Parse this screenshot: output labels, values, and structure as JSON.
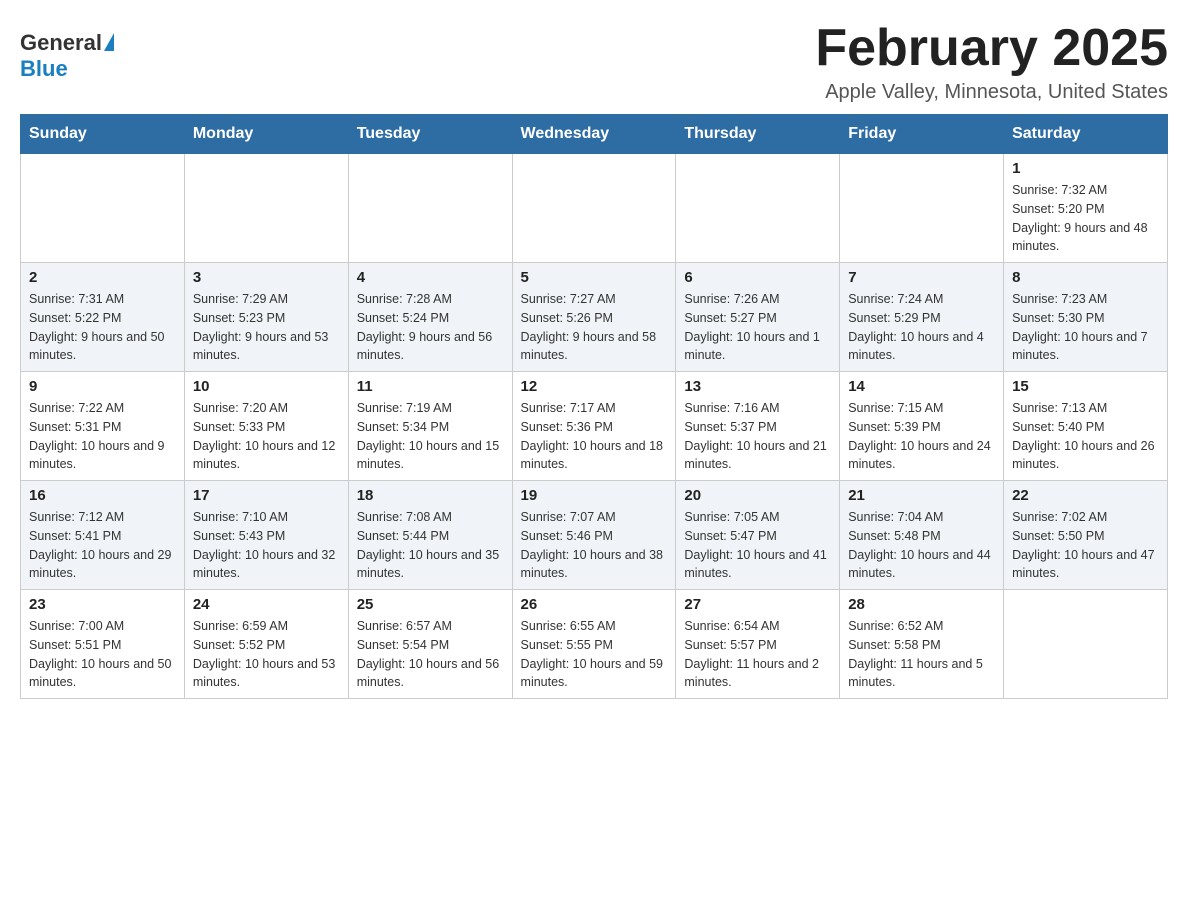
{
  "header": {
    "logo_general": "General",
    "logo_blue": "Blue",
    "month_title": "February 2025",
    "location": "Apple Valley, Minnesota, United States"
  },
  "days_of_week": [
    "Sunday",
    "Monday",
    "Tuesday",
    "Wednesday",
    "Thursday",
    "Friday",
    "Saturday"
  ],
  "weeks": [
    {
      "days": [
        {
          "date": "",
          "info": ""
        },
        {
          "date": "",
          "info": ""
        },
        {
          "date": "",
          "info": ""
        },
        {
          "date": "",
          "info": ""
        },
        {
          "date": "",
          "info": ""
        },
        {
          "date": "",
          "info": ""
        },
        {
          "date": "1",
          "info": "Sunrise: 7:32 AM\nSunset: 5:20 PM\nDaylight: 9 hours and 48 minutes."
        }
      ]
    },
    {
      "days": [
        {
          "date": "2",
          "info": "Sunrise: 7:31 AM\nSunset: 5:22 PM\nDaylight: 9 hours and 50 minutes."
        },
        {
          "date": "3",
          "info": "Sunrise: 7:29 AM\nSunset: 5:23 PM\nDaylight: 9 hours and 53 minutes."
        },
        {
          "date": "4",
          "info": "Sunrise: 7:28 AM\nSunset: 5:24 PM\nDaylight: 9 hours and 56 minutes."
        },
        {
          "date": "5",
          "info": "Sunrise: 7:27 AM\nSunset: 5:26 PM\nDaylight: 9 hours and 58 minutes."
        },
        {
          "date": "6",
          "info": "Sunrise: 7:26 AM\nSunset: 5:27 PM\nDaylight: 10 hours and 1 minute."
        },
        {
          "date": "7",
          "info": "Sunrise: 7:24 AM\nSunset: 5:29 PM\nDaylight: 10 hours and 4 minutes."
        },
        {
          "date": "8",
          "info": "Sunrise: 7:23 AM\nSunset: 5:30 PM\nDaylight: 10 hours and 7 minutes."
        }
      ]
    },
    {
      "days": [
        {
          "date": "9",
          "info": "Sunrise: 7:22 AM\nSunset: 5:31 PM\nDaylight: 10 hours and 9 minutes."
        },
        {
          "date": "10",
          "info": "Sunrise: 7:20 AM\nSunset: 5:33 PM\nDaylight: 10 hours and 12 minutes."
        },
        {
          "date": "11",
          "info": "Sunrise: 7:19 AM\nSunset: 5:34 PM\nDaylight: 10 hours and 15 minutes."
        },
        {
          "date": "12",
          "info": "Sunrise: 7:17 AM\nSunset: 5:36 PM\nDaylight: 10 hours and 18 minutes."
        },
        {
          "date": "13",
          "info": "Sunrise: 7:16 AM\nSunset: 5:37 PM\nDaylight: 10 hours and 21 minutes."
        },
        {
          "date": "14",
          "info": "Sunrise: 7:15 AM\nSunset: 5:39 PM\nDaylight: 10 hours and 24 minutes."
        },
        {
          "date": "15",
          "info": "Sunrise: 7:13 AM\nSunset: 5:40 PM\nDaylight: 10 hours and 26 minutes."
        }
      ]
    },
    {
      "days": [
        {
          "date": "16",
          "info": "Sunrise: 7:12 AM\nSunset: 5:41 PM\nDaylight: 10 hours and 29 minutes."
        },
        {
          "date": "17",
          "info": "Sunrise: 7:10 AM\nSunset: 5:43 PM\nDaylight: 10 hours and 32 minutes."
        },
        {
          "date": "18",
          "info": "Sunrise: 7:08 AM\nSunset: 5:44 PM\nDaylight: 10 hours and 35 minutes."
        },
        {
          "date": "19",
          "info": "Sunrise: 7:07 AM\nSunset: 5:46 PM\nDaylight: 10 hours and 38 minutes."
        },
        {
          "date": "20",
          "info": "Sunrise: 7:05 AM\nSunset: 5:47 PM\nDaylight: 10 hours and 41 minutes."
        },
        {
          "date": "21",
          "info": "Sunrise: 7:04 AM\nSunset: 5:48 PM\nDaylight: 10 hours and 44 minutes."
        },
        {
          "date": "22",
          "info": "Sunrise: 7:02 AM\nSunset: 5:50 PM\nDaylight: 10 hours and 47 minutes."
        }
      ]
    },
    {
      "days": [
        {
          "date": "23",
          "info": "Sunrise: 7:00 AM\nSunset: 5:51 PM\nDaylight: 10 hours and 50 minutes."
        },
        {
          "date": "24",
          "info": "Sunrise: 6:59 AM\nSunset: 5:52 PM\nDaylight: 10 hours and 53 minutes."
        },
        {
          "date": "25",
          "info": "Sunrise: 6:57 AM\nSunset: 5:54 PM\nDaylight: 10 hours and 56 minutes."
        },
        {
          "date": "26",
          "info": "Sunrise: 6:55 AM\nSunset: 5:55 PM\nDaylight: 10 hours and 59 minutes."
        },
        {
          "date": "27",
          "info": "Sunrise: 6:54 AM\nSunset: 5:57 PM\nDaylight: 11 hours and 2 minutes."
        },
        {
          "date": "28",
          "info": "Sunrise: 6:52 AM\nSunset: 5:58 PM\nDaylight: 11 hours and 5 minutes."
        },
        {
          "date": "",
          "info": ""
        }
      ]
    }
  ]
}
